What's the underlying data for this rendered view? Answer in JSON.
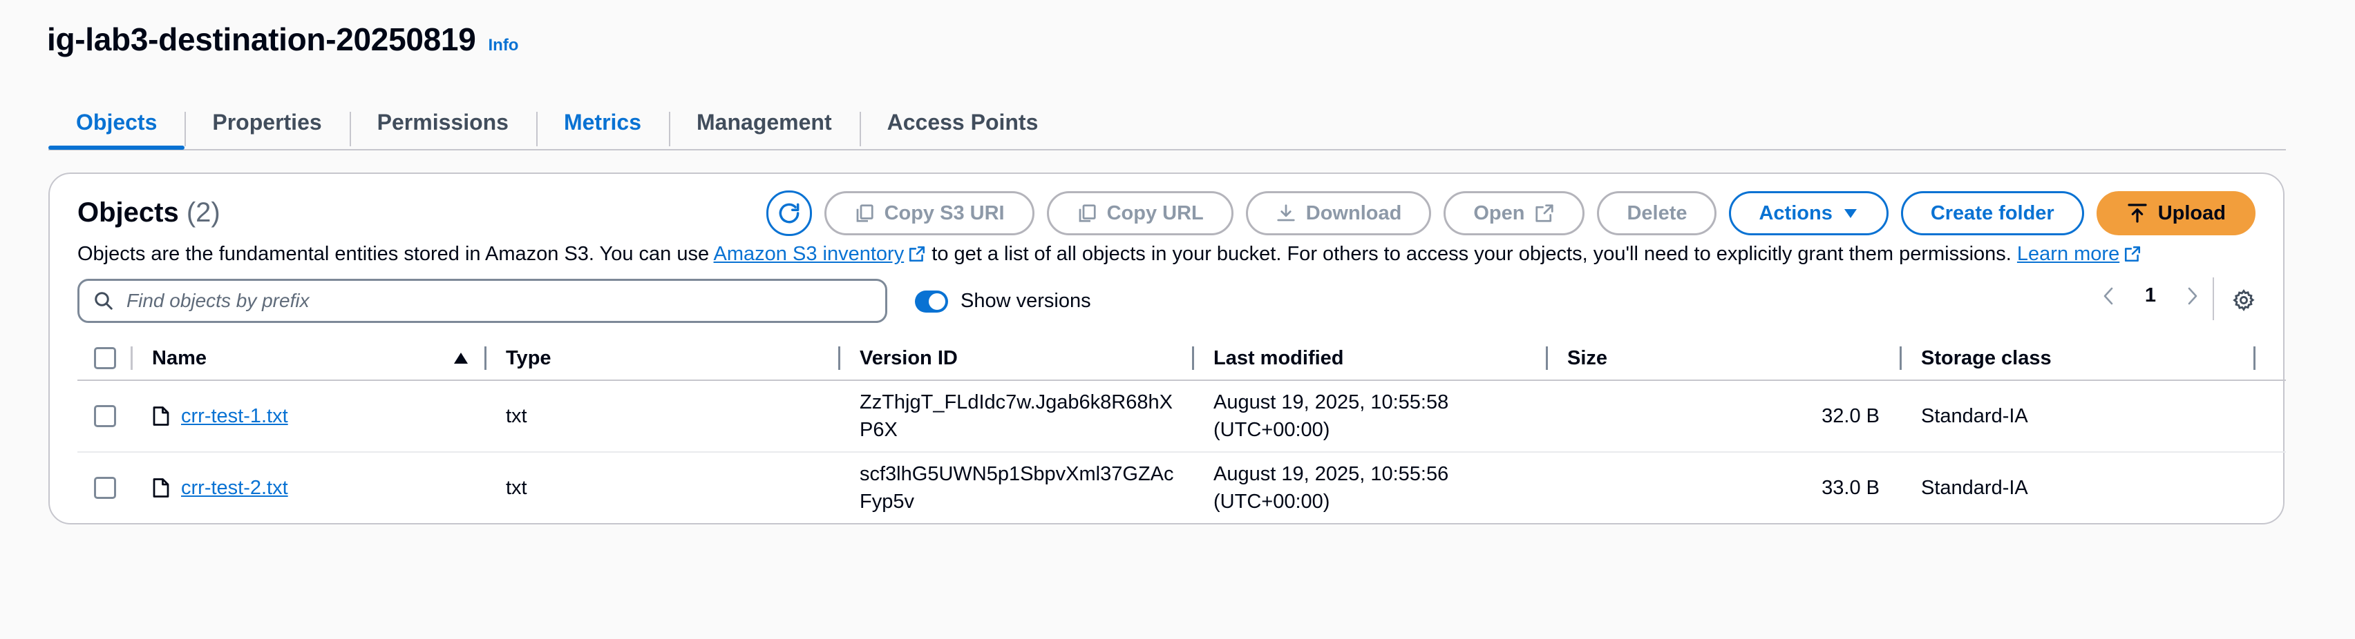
{
  "header": {
    "bucket_name": "ig-lab3-destination-20250819",
    "info_label": "Info"
  },
  "tabs": [
    {
      "label": "Objects"
    },
    {
      "label": "Properties"
    },
    {
      "label": "Permissions"
    },
    {
      "label": "Metrics"
    },
    {
      "label": "Management"
    },
    {
      "label": "Access Points"
    }
  ],
  "objects_panel": {
    "heading": "Objects",
    "count": "(2)",
    "description_prefix": "Objects are the fundamental entities stored in Amazon S3. You can use ",
    "inventory_link": "Amazon S3 inventory",
    "description_middle": " to get a list of all objects in your bucket. For others to access your objects, you'll need to explicitly grant them permissions. ",
    "learn_more_link": "Learn more"
  },
  "toolbar": {
    "copy_s3_uri": "Copy S3 URI",
    "copy_url": "Copy URL",
    "download": "Download",
    "open": "Open",
    "delete": "Delete",
    "actions": "Actions",
    "create_folder": "Create folder",
    "upload": "Upload"
  },
  "search": {
    "placeholder": "Find objects by prefix",
    "value": ""
  },
  "versions_toggle": {
    "label": "Show versions",
    "enabled": true
  },
  "pagination": {
    "current_page": "1"
  },
  "table": {
    "columns": {
      "name": "Name",
      "type": "Type",
      "version_id": "Version ID",
      "last_modified": "Last modified",
      "size": "Size",
      "storage_class": "Storage class"
    },
    "rows": [
      {
        "name": "crr-test-1.txt",
        "type": "txt",
        "version_line1": "ZzThjgT_FLdIdc7w.Jgab6k8R68hX",
        "version_line2": "P6X",
        "modified_line1": "August 19, 2025, 10:55:58",
        "modified_line2": "(UTC+00:00)",
        "size": "32.0 B",
        "storage_class": "Standard-IA"
      },
      {
        "name": "crr-test-2.txt",
        "type": "txt",
        "version_line1": "scf3lhG5UWN5p1SbpvXml37GZAc",
        "version_line2": "Fyp5v",
        "modified_line1": "August 19, 2025, 10:55:56",
        "modified_line2": "(UTC+00:00)",
        "size": "33.0 B",
        "storage_class": "Standard-IA"
      }
    ]
  },
  "colors": {
    "accent": "#0972d3",
    "upload_button": "#f29e3c",
    "disabled": "#8d99a8"
  },
  "icons": {
    "refresh": "refresh-icon",
    "copy": "copy-icon",
    "download": "download-icon",
    "external": "external-link-icon",
    "dropdown": "caret-down-icon",
    "upload": "upload-icon",
    "search": "search-icon",
    "settings": "gear-icon",
    "file": "file-icon",
    "sort": "sort-ascending-icon"
  }
}
